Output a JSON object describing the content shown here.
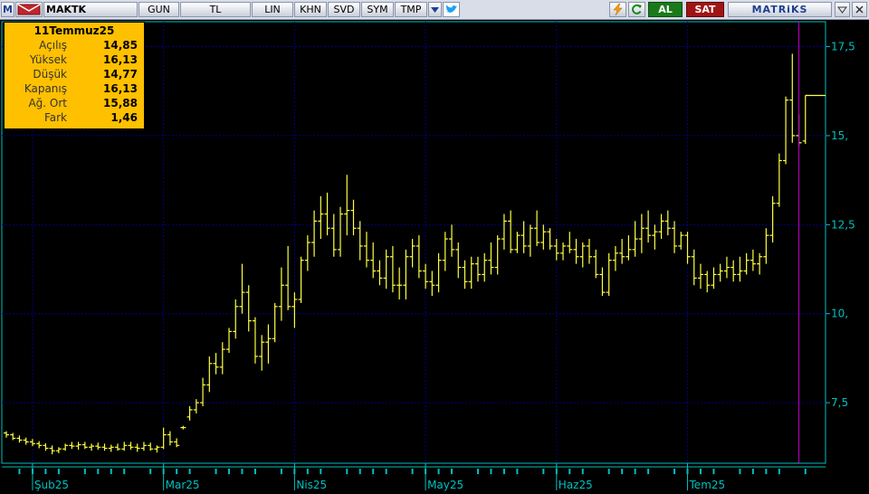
{
  "toolbar": {
    "app_letter": "M",
    "symbol": "MAKTK",
    "buttons": [
      "GUN",
      "TL",
      "LIN",
      "KHN",
      "SVD",
      "SYM",
      "TMP"
    ],
    "buy_label": "AL",
    "sell_label": "SAT",
    "brand": "MATRiKS",
    "colors": {
      "buy": "#1a7a1a",
      "sell": "#a01414",
      "brand_text": "#1f3e8f"
    }
  },
  "info_panel": {
    "date": "11Temmuz25",
    "rows": [
      {
        "label": "Açılış",
        "value": "14,85"
      },
      {
        "label": "Yüksek",
        "value": "16,13"
      },
      {
        "label": "Düşük",
        "value": "14,77"
      },
      {
        "label": "Kapanış",
        "value": "16,13"
      },
      {
        "label": "Ağ. Ort",
        "value": "15,88"
      },
      {
        "label": "Fark",
        "value": "1,46"
      }
    ]
  },
  "chart_data": {
    "type": "line",
    "style": "ohlc",
    "y_ticks": [
      {
        "value": 7.5,
        "label": "7,5"
      },
      {
        "value": 10,
        "label": "10,"
      },
      {
        "value": 12.5,
        "label": "12,5"
      },
      {
        "value": 15,
        "label": "15,"
      },
      {
        "value": 17.5,
        "label": "17,5"
      }
    ],
    "x_ticks": [
      {
        "index": 4,
        "label": "Şub25"
      },
      {
        "index": 24,
        "label": "Mar25"
      },
      {
        "index": 44,
        "label": "Nis25"
      },
      {
        "index": 64,
        "label": "May25"
      },
      {
        "index": 84,
        "label": "Haz25"
      },
      {
        "index": 104,
        "label": "Tem25"
      }
    ],
    "ylim": [
      5.8,
      18.2
    ],
    "grid": true,
    "colors": {
      "bars": "#ffff40",
      "grid": "#00008c",
      "axis": "#00c0c0",
      "cursor": "#c000c0"
    },
    "bars": [
      [
        6.65,
        6.7,
        6.52,
        6.6
      ],
      [
        6.6,
        6.65,
        6.45,
        6.5
      ],
      [
        6.5,
        6.58,
        6.38,
        6.45
      ],
      [
        6.45,
        6.52,
        6.32,
        6.4
      ],
      [
        6.4,
        6.48,
        6.28,
        6.35
      ],
      [
        6.35,
        6.42,
        6.22,
        6.3
      ],
      [
        6.3,
        6.36,
        6.15,
        6.22
      ],
      [
        6.22,
        6.3,
        6.05,
        6.15
      ],
      [
        6.15,
        6.25,
        6.08,
        6.2
      ],
      [
        6.2,
        6.35,
        6.15,
        6.3
      ],
      [
        6.3,
        6.4,
        6.2,
        6.28
      ],
      [
        6.28,
        6.4,
        6.18,
        6.32
      ],
      [
        6.32,
        6.4,
        6.2,
        6.25
      ],
      [
        6.25,
        6.35,
        6.15,
        6.28
      ],
      [
        6.28,
        6.38,
        6.18,
        6.25
      ],
      [
        6.25,
        6.35,
        6.15,
        6.22
      ],
      [
        6.22,
        6.32,
        6.12,
        6.25
      ],
      [
        6.25,
        6.35,
        6.15,
        6.2
      ],
      [
        6.2,
        6.4,
        6.15,
        6.3
      ],
      [
        6.3,
        6.4,
        6.18,
        6.25
      ],
      [
        6.25,
        6.35,
        6.12,
        6.22
      ],
      [
        6.22,
        6.4,
        6.15,
        6.3
      ],
      [
        6.3,
        6.38,
        6.15,
        6.2
      ],
      [
        6.2,
        6.3,
        6.1,
        6.25
      ],
      [
        6.25,
        6.8,
        6.2,
        6.6
      ],
      [
        6.6,
        6.7,
        6.3,
        6.4
      ],
      [
        6.4,
        6.5,
        6.25,
        6.3
      ],
      [
        6.8,
        6.85,
        6.75,
        6.8
      ],
      [
        7.1,
        7.4,
        7.0,
        7.3
      ],
      [
        7.3,
        7.6,
        7.2,
        7.5
      ],
      [
        7.5,
        8.2,
        7.4,
        8.0
      ],
      [
        8.0,
        8.8,
        7.8,
        8.6
      ],
      [
        8.6,
        8.9,
        8.3,
        8.5
      ],
      [
        8.5,
        9.2,
        8.3,
        9.0
      ],
      [
        9.0,
        9.6,
        8.9,
        9.5
      ],
      [
        9.5,
        10.4,
        9.3,
        10.2
      ],
      [
        10.2,
        11.4,
        10.0,
        10.6
      ],
      [
        10.6,
        10.8,
        9.5,
        9.8
      ],
      [
        9.8,
        9.9,
        8.6,
        8.8
      ],
      [
        8.8,
        9.4,
        8.4,
        9.2
      ],
      [
        9.2,
        9.7,
        8.6,
        9.3
      ],
      [
        9.3,
        10.3,
        9.2,
        10.2
      ],
      [
        10.2,
        11.3,
        9.8,
        10.8
      ],
      [
        10.8,
        11.9,
        10.1,
        10.2
      ],
      [
        10.2,
        10.6,
        9.6,
        10.4
      ],
      [
        10.4,
        11.6,
        10.3,
        11.5
      ],
      [
        11.5,
        12.2,
        11.2,
        12.0
      ],
      [
        12.0,
        12.9,
        11.6,
        12.6
      ],
      [
        12.6,
        13.3,
        12.1,
        12.8
      ],
      [
        12.8,
        13.4,
        12.2,
        12.4
      ],
      [
        12.4,
        12.8,
        11.6,
        11.8
      ],
      [
        11.8,
        13.0,
        11.6,
        12.8
      ],
      [
        12.8,
        13.9,
        12.2,
        12.9
      ],
      [
        12.9,
        13.2,
        12.2,
        12.4
      ],
      [
        12.4,
        12.6,
        11.5,
        11.9
      ],
      [
        11.9,
        12.3,
        11.3,
        11.5
      ],
      [
        11.5,
        12.0,
        11.0,
        11.2
      ],
      [
        11.2,
        11.5,
        10.8,
        11.0
      ],
      [
        11.0,
        11.8,
        10.7,
        11.6
      ],
      [
        11.6,
        11.9,
        10.6,
        10.8
      ],
      [
        10.8,
        11.3,
        10.4,
        10.8
      ],
      [
        10.8,
        11.8,
        10.4,
        11.6
      ],
      [
        11.6,
        12.1,
        11.3,
        11.9
      ],
      [
        11.9,
        12.2,
        11.0,
        11.2
      ],
      [
        11.2,
        11.4,
        10.7,
        10.9
      ],
      [
        10.9,
        11.2,
        10.5,
        10.8
      ],
      [
        10.8,
        11.7,
        10.6,
        11.5
      ],
      [
        11.5,
        12.3,
        11.2,
        12.1
      ],
      [
        12.1,
        12.5,
        11.6,
        11.8
      ],
      [
        11.8,
        12.0,
        11.0,
        11.3
      ],
      [
        11.3,
        11.5,
        10.7,
        10.9
      ],
      [
        10.9,
        11.6,
        10.7,
        11.4
      ],
      [
        11.4,
        11.6,
        10.9,
        11.1
      ],
      [
        11.1,
        11.7,
        10.9,
        11.5
      ],
      [
        11.5,
        12.0,
        11.1,
        11.3
      ],
      [
        11.3,
        12.2,
        11.1,
        12.1
      ],
      [
        12.1,
        12.8,
        11.8,
        12.6
      ],
      [
        12.6,
        12.9,
        11.7,
        11.8
      ],
      [
        11.8,
        12.3,
        11.7,
        12.2
      ],
      [
        12.2,
        12.6,
        11.7,
        11.9
      ],
      [
        11.9,
        12.5,
        11.6,
        12.4
      ],
      [
        12.4,
        12.9,
        11.9,
        12.0
      ],
      [
        12.0,
        12.5,
        11.8,
        12.3
      ],
      [
        12.3,
        12.4,
        11.8,
        11.9
      ],
      [
        11.9,
        12.1,
        11.5,
        11.7
      ],
      [
        11.7,
        12.0,
        11.5,
        11.9
      ],
      [
        11.9,
        12.3,
        11.7,
        11.8
      ],
      [
        11.8,
        12.1,
        11.4,
        11.6
      ],
      [
        11.6,
        12.0,
        11.3,
        11.9
      ],
      [
        11.9,
        12.1,
        11.4,
        11.6
      ],
      [
        11.6,
        11.8,
        11.0,
        11.1
      ],
      [
        11.1,
        11.3,
        10.5,
        10.6
      ],
      [
        10.6,
        11.7,
        10.5,
        11.5
      ],
      [
        11.5,
        11.9,
        11.2,
        11.7
      ],
      [
        11.7,
        12.1,
        11.4,
        11.6
      ],
      [
        11.6,
        12.2,
        11.5,
        11.8
      ],
      [
        11.8,
        12.6,
        11.6,
        12.1
      ],
      [
        12.1,
        12.8,
        11.7,
        12.4
      ],
      [
        12.4,
        12.9,
        12.0,
        12.2
      ],
      [
        12.2,
        12.5,
        11.8,
        12.3
      ],
      [
        12.3,
        12.8,
        12.1,
        12.6
      ],
      [
        12.6,
        12.9,
        12.2,
        12.4
      ],
      [
        12.4,
        12.6,
        11.7,
        11.9
      ],
      [
        11.9,
        12.3,
        11.8,
        12.2
      ],
      [
        12.2,
        12.3,
        11.4,
        11.6
      ],
      [
        11.6,
        11.8,
        10.8,
        11.0
      ],
      [
        11.0,
        11.4,
        10.7,
        11.1
      ],
      [
        11.1,
        11.2,
        10.6,
        10.8
      ],
      [
        10.8,
        11.3,
        10.7,
        11.1
      ],
      [
        11.1,
        11.4,
        10.9,
        11.2
      ],
      [
        11.2,
        11.6,
        11.0,
        11.3
      ],
      [
        11.3,
        11.5,
        10.9,
        11.1
      ],
      [
        11.1,
        11.6,
        10.9,
        11.2
      ],
      [
        11.2,
        11.7,
        11.1,
        11.5
      ],
      [
        11.5,
        11.8,
        11.2,
        11.4
      ],
      [
        11.4,
        11.7,
        11.1,
        11.6
      ],
      [
        11.6,
        12.4,
        11.4,
        12.2
      ],
      [
        12.2,
        13.3,
        12.0,
        13.1
      ],
      [
        13.1,
        14.5,
        13.0,
        14.3
      ],
      [
        14.3,
        16.1,
        14.2,
        16.0
      ],
      [
        16.0,
        17.3,
        14.8,
        15.0
      ],
      [
        15.0,
        15.6,
        14.7,
        14.8
      ],
      [
        14.85,
        16.13,
        14.77,
        16.13
      ]
    ]
  }
}
